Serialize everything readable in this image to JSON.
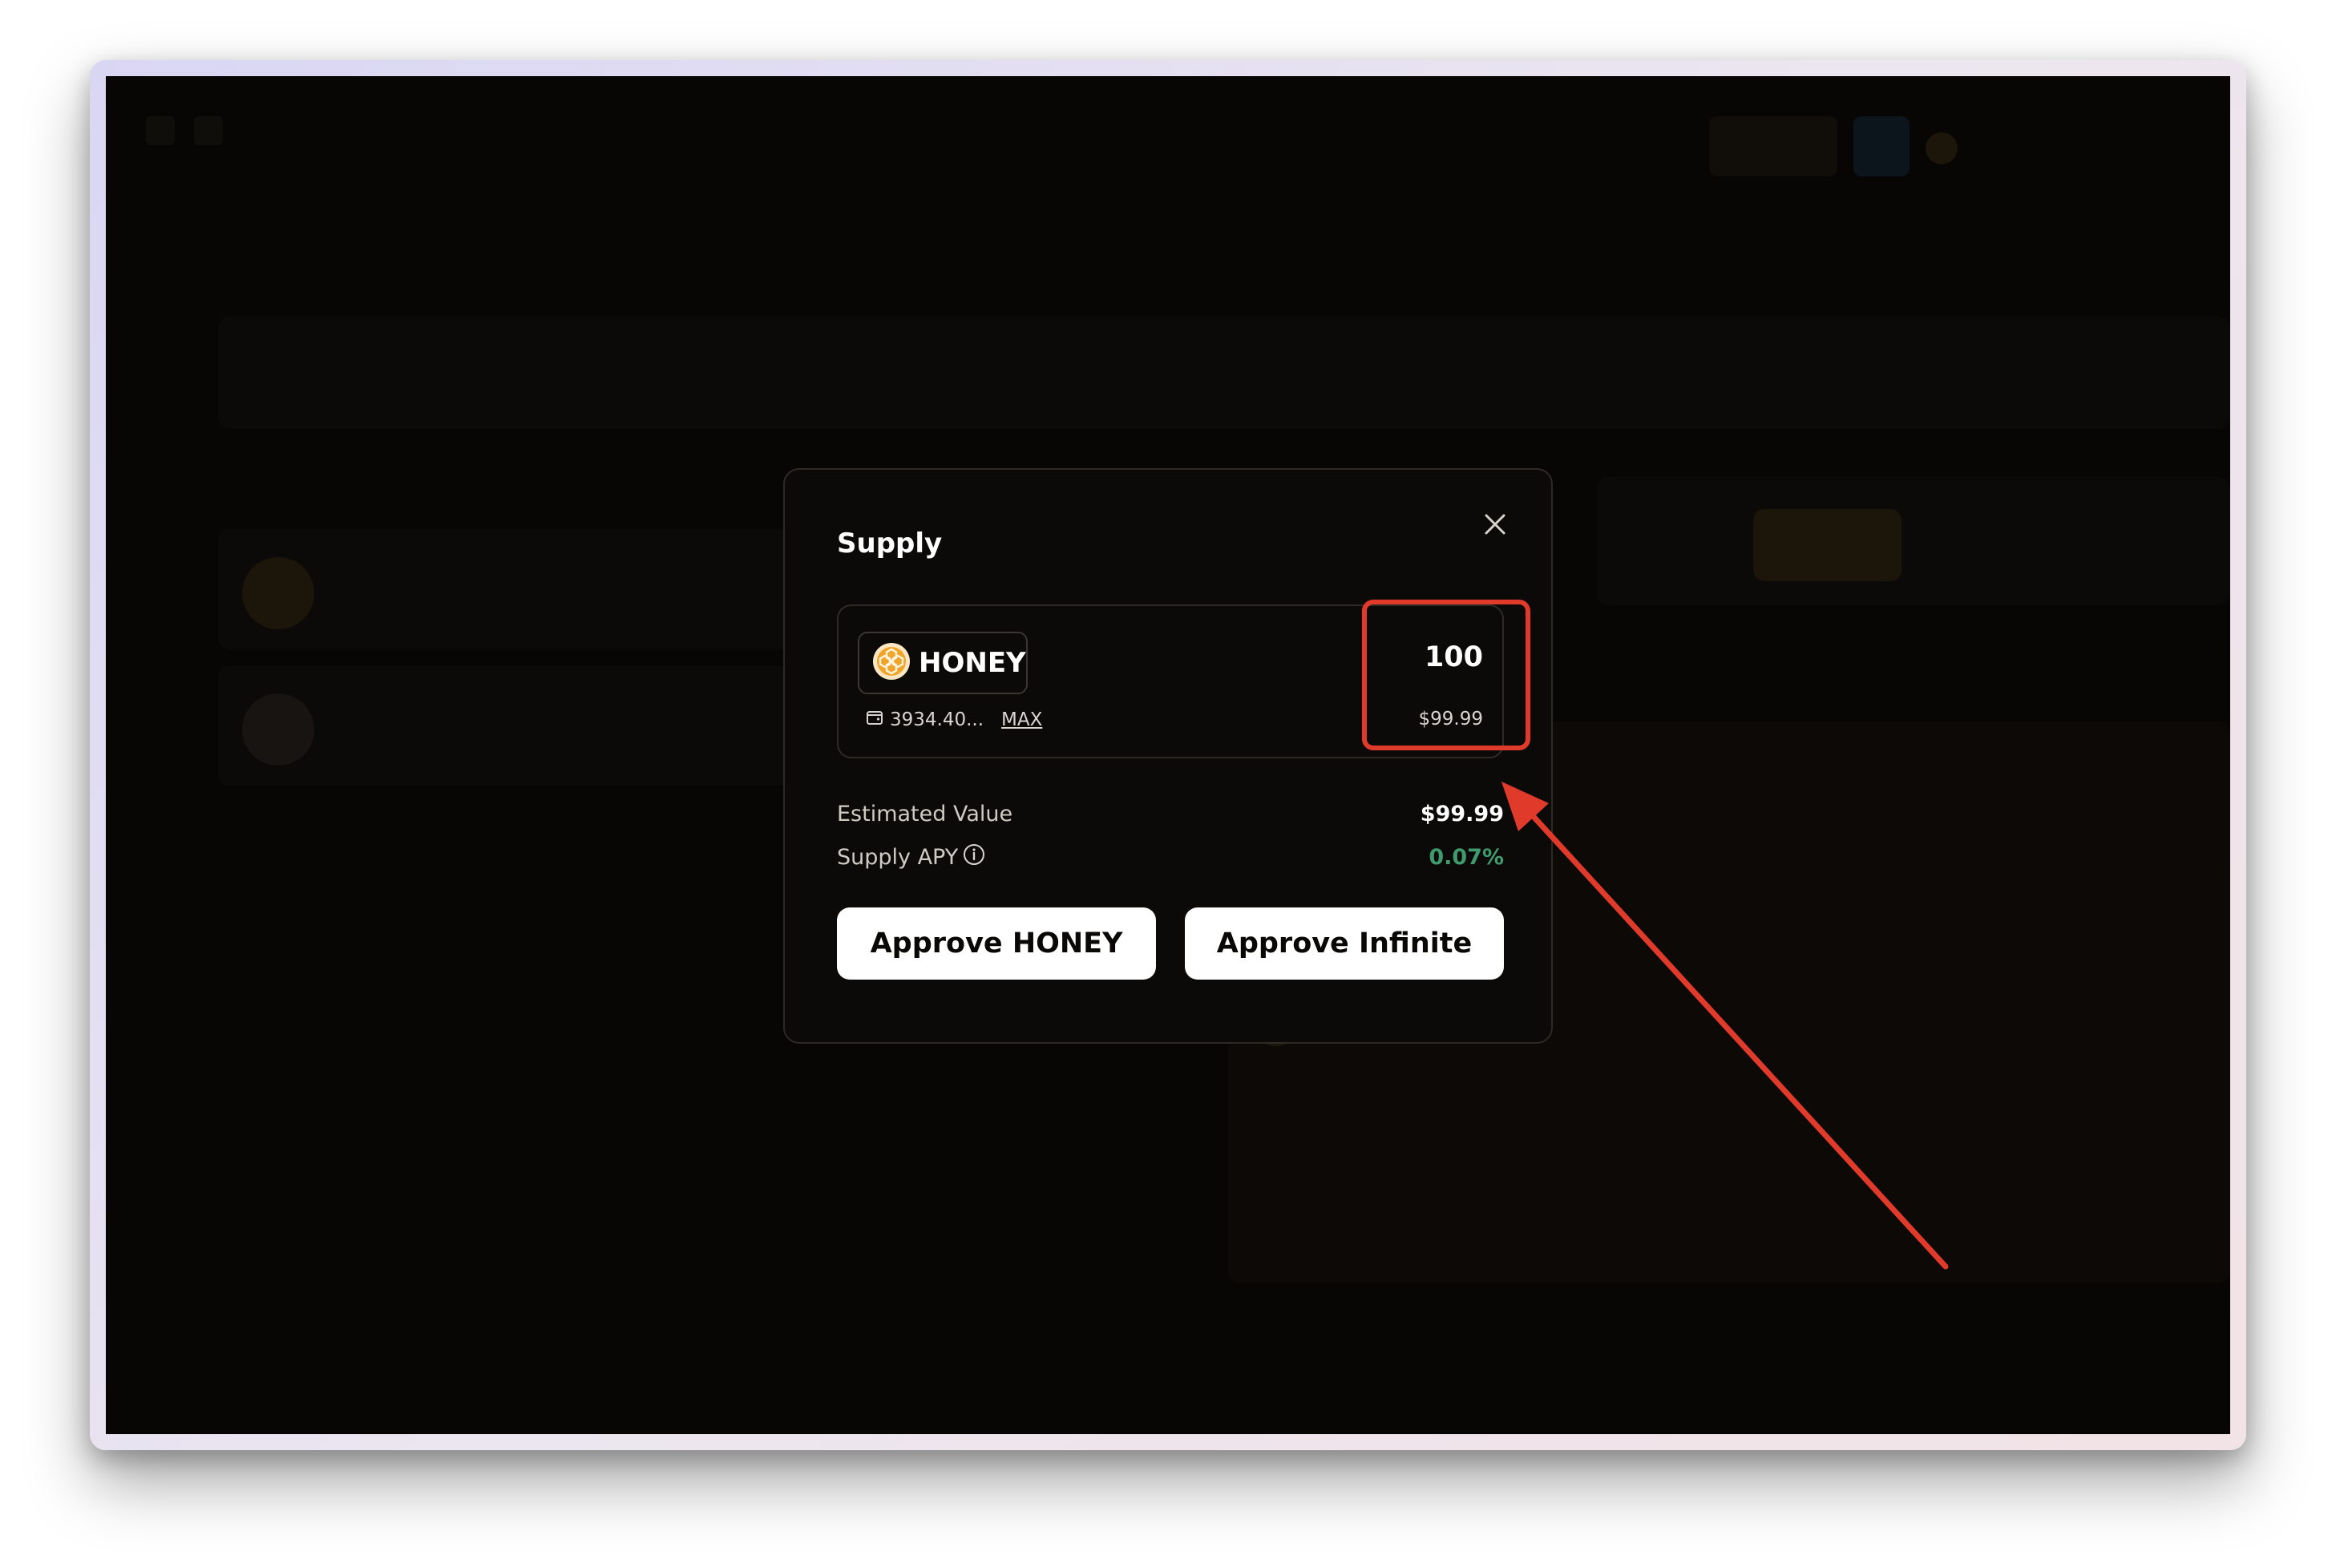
{
  "modal": {
    "title": "Supply",
    "token_symbol": "HONEY",
    "wallet_balance": "3934.40...",
    "max_label": "MAX",
    "amount": "100",
    "amount_usd": "$99.99",
    "estimated_value_label": "Estimated Value",
    "estimated_value": "$99.99",
    "supply_apy_label": "Supply APY",
    "supply_apy": "0.07%",
    "approve_token_label": "Approve HONEY",
    "approve_infinite_label": "Approve Infinite"
  },
  "colors": {
    "apy_green": "#3f9b6e",
    "highlight_red": "#e03a2a",
    "honey_gold": "#f0a52a"
  },
  "icons": {
    "close": "close-icon",
    "token": "honey-token-icon",
    "wallet": "wallet-icon",
    "info": "info-icon"
  }
}
